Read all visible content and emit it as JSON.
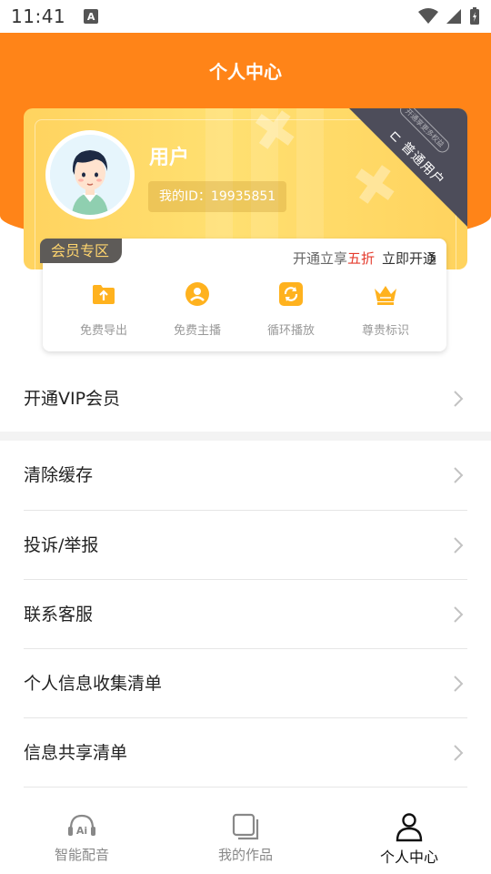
{
  "status_bar": {
    "time": "11:41",
    "notification_icon": "a-icon"
  },
  "header": {
    "title": "个人中心"
  },
  "profile_card": {
    "username": "用户",
    "user_id": "我的ID：19935851",
    "corner_label": "普通用户",
    "corner_badge": "开通享更多权益"
  },
  "member_zone": {
    "tag": "会员专区",
    "promo_prefix": "开通立享",
    "promo_highlight": "五折",
    "open_label": "立即开通",
    "benefits": [
      {
        "label": "免费导出",
        "icon": "export-folder-icon"
      },
      {
        "label": "免费主播",
        "icon": "anchor-icon"
      },
      {
        "label": "循环播放",
        "icon": "loop-icon"
      },
      {
        "label": "尊贵标识",
        "icon": "crown-icon"
      }
    ]
  },
  "menu": {
    "vip": "开通VIP会员",
    "items": [
      "清除缓存",
      "投诉/举报",
      "联系客服",
      "个人信息收集清单",
      "信息共享清单"
    ]
  },
  "bottom_nav": {
    "items": [
      {
        "label": "智能配音",
        "icon": "ai-headset-icon",
        "active": false
      },
      {
        "label": "我的作品",
        "icon": "works-icon",
        "active": false
      },
      {
        "label": "个人中心",
        "icon": "profile-icon",
        "active": true
      }
    ]
  },
  "colors": {
    "accent": "#ff8418",
    "card": "#ffd766",
    "highlight": "#e53b2d",
    "zone_tag_bg": "#5e5b58"
  }
}
